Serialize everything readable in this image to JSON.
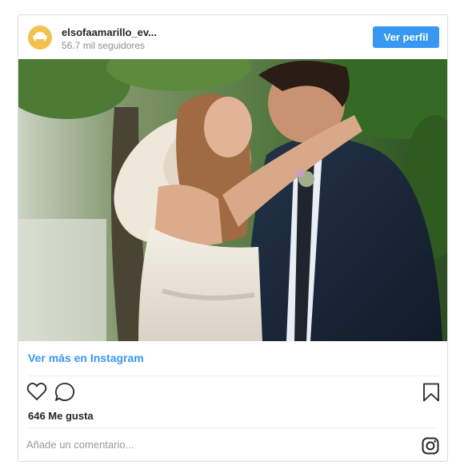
{
  "post": {
    "username": "elsofaamarillo_ev...",
    "followers": "56.7 mil seguidores",
    "view_profile_label": "Ver perfil",
    "view_more_label": "Ver más en Instagram",
    "likes": "646 Me gusta",
    "comment_placeholder": "Añade un comentario..."
  },
  "icons": {
    "avatar": "sofa-logo-icon",
    "like": "heart-icon",
    "comment": "comment-bubble-icon",
    "save": "bookmark-icon",
    "brand": "instagram-icon"
  },
  "colors": {
    "accent": "#3897f0",
    "avatar": "#f2c14e",
    "border": "#dbdbdb",
    "muted": "#8e8e8e"
  }
}
